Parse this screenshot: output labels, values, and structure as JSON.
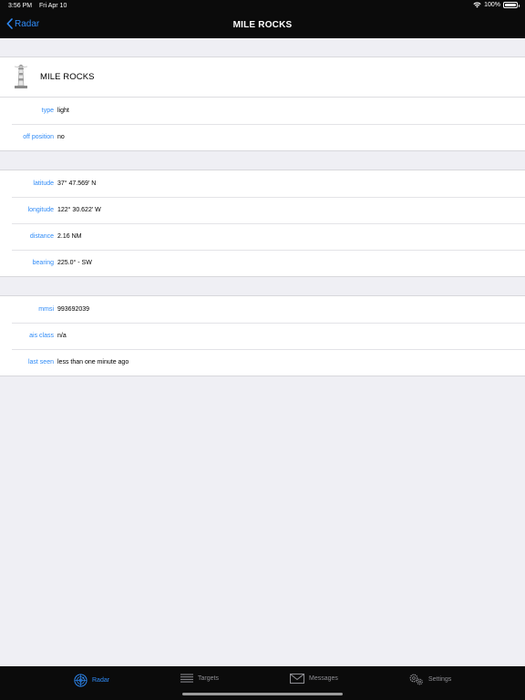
{
  "status": {
    "time": "3:56 PM",
    "date": "Fri Apr 10",
    "battery": "100%"
  },
  "nav": {
    "back_label": "Radar",
    "title": "MILE ROCKS"
  },
  "header": {
    "name": "MILE ROCKS",
    "icon": "lighthouse-icon"
  },
  "sections": [
    [
      {
        "label": "type",
        "value": "light"
      },
      {
        "label": "off position",
        "value": "no"
      }
    ],
    [
      {
        "label": "latitude",
        "value": "37° 47.569' N"
      },
      {
        "label": "longitude",
        "value": "122° 30.622' W"
      },
      {
        "label": "distance",
        "value": "2.16 NM"
      },
      {
        "label": "bearing",
        "value": "225.0° - SW"
      }
    ],
    [
      {
        "label": "mmsi",
        "value": "993692039"
      },
      {
        "label": "ais class",
        "value": "n/a"
      },
      {
        "label": "last seen",
        "value": "less than one minute ago"
      }
    ]
  ],
  "tabs": [
    {
      "label": "Radar",
      "icon": "radar-icon",
      "active": true
    },
    {
      "label": "Targets",
      "icon": "list-icon",
      "active": false
    },
    {
      "label": "Messages",
      "icon": "envelope-icon",
      "active": false
    },
    {
      "label": "Settings",
      "icon": "gears-icon",
      "active": false
    }
  ],
  "colors": {
    "accent": "#2f8bf7",
    "bar": "#0b0b0b",
    "background": "#efeff4"
  }
}
